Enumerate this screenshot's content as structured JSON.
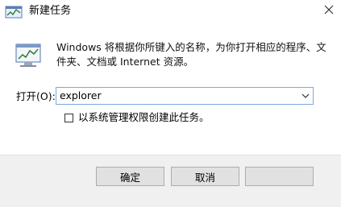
{
  "window": {
    "title": "新建任务",
    "close_icon": "close-icon"
  },
  "content": {
    "description": "Windows 将根据你所键入的名称，为你打开相应的程序、文件夹、文档或 Internet 资源。",
    "open_label": "打开(O):",
    "input_value": "explorer",
    "checkbox_label": "以系统管理权限创建此任务。",
    "checkbox_checked": false
  },
  "footer": {
    "ok_label": "确定",
    "cancel_label": "取消",
    "browse_label": ""
  },
  "colors": {
    "accent_border": "#7aa9e0",
    "footer_bg": "#f0f0f0",
    "button_bg": "#e1e1e1"
  }
}
